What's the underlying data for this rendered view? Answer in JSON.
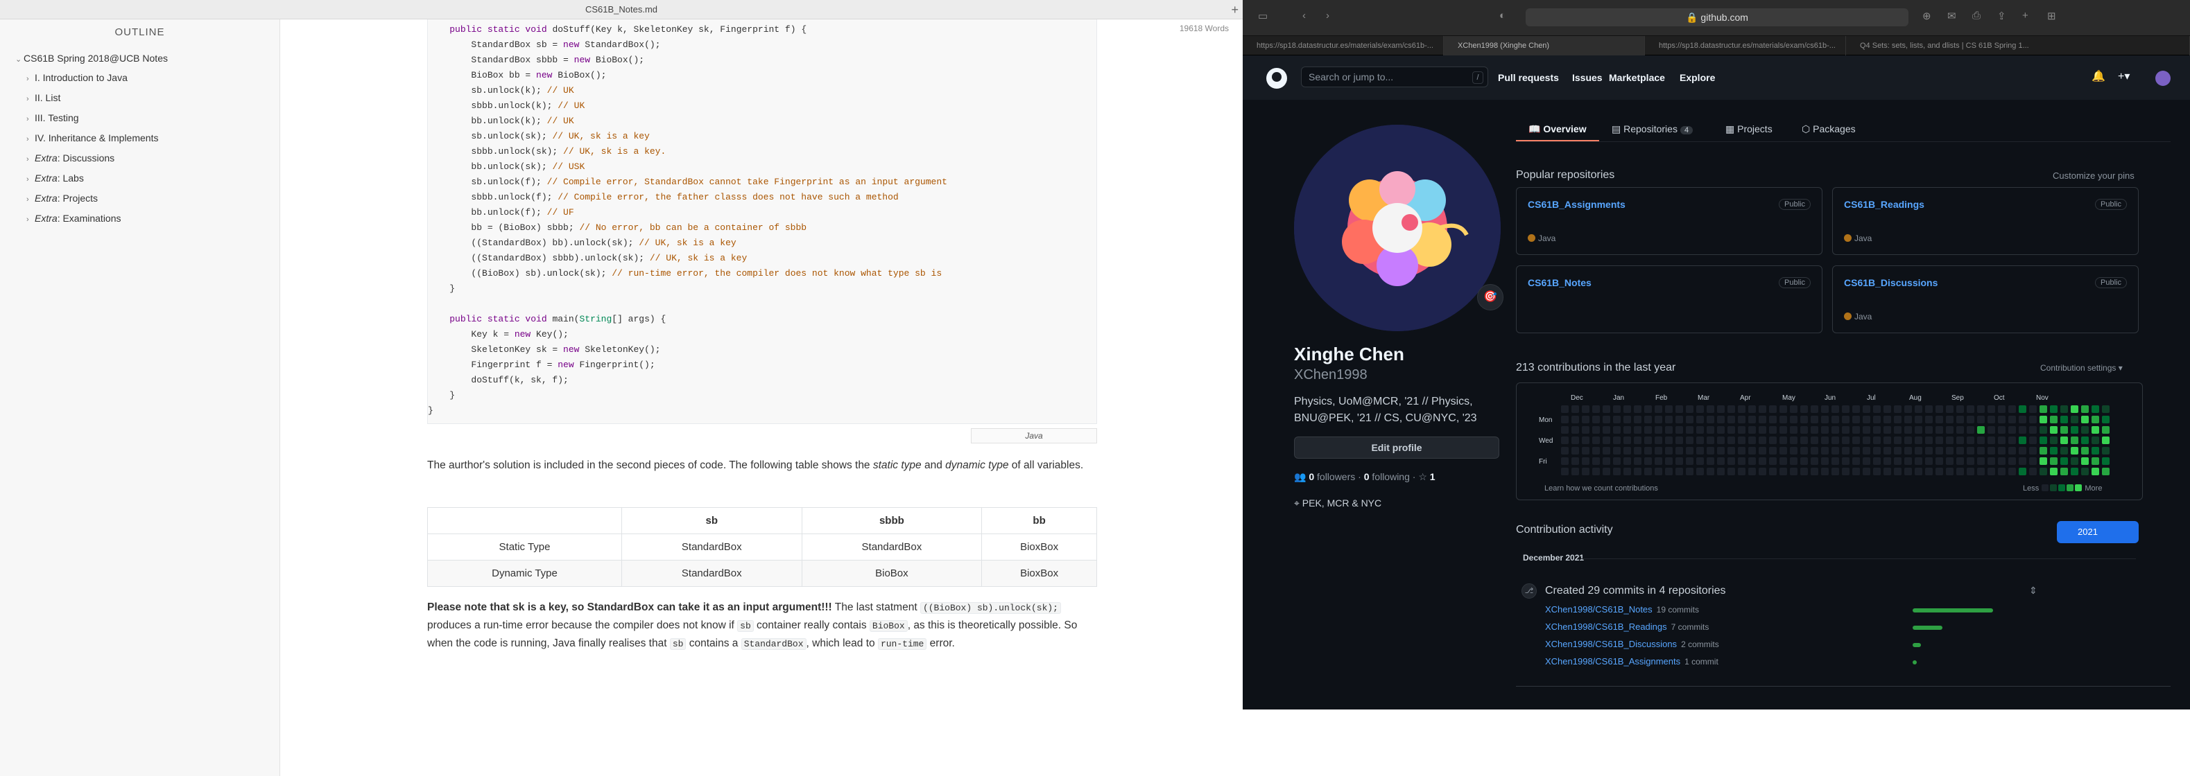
{
  "typora": {
    "window_title": "CS61B_Notes.md",
    "outline_header": "OUTLINE",
    "outline_root": "CS61B Spring 2018@UCB Notes",
    "outline_items": [
      {
        "prefix": "",
        "label": "I. Introduction to Java"
      },
      {
        "prefix": "",
        "label": "II. List"
      },
      {
        "prefix": "",
        "label": "III. Testing"
      },
      {
        "prefix": "",
        "label": "IV. Inheritance & Implements"
      },
      {
        "prefix": "Extra",
        "label": ": Discussions"
      },
      {
        "prefix": "Extra",
        "label": ": Labs"
      },
      {
        "prefix": "Extra",
        "label": ": Projects"
      },
      {
        "prefix": "Extra",
        "label": ": Examinations"
      }
    ],
    "word_count": "19618 Words",
    "code_lang": "Java",
    "paragraph1_a": "The aurthor's solution is included in the second pieces of code. The following table shows the ",
    "paragraph1_em1": "static type",
    "paragraph1_b": " and ",
    "paragraph1_em2": "dynamic type",
    "paragraph1_c": " of all variables.",
    "table": {
      "headers": [
        "",
        "sb",
        "sbbb",
        "bb"
      ],
      "rows": [
        [
          "Static Type",
          "StandardBox",
          "StandardBox",
          "BioxBox"
        ],
        [
          "Dynamic Type",
          "StandardBox",
          "BioBox",
          "BioxBox"
        ]
      ]
    },
    "note_bold": "Please note that sk is a key, so StandardBox can take it as an input argument!!!",
    "note_t1": " The last statment ",
    "note_code1": "((BioBox) sb).unlock(sk);",
    "note_t2": " produces a run-time error because the compiler does not know if ",
    "note_code2": "sb",
    "note_t3": " container really contais ",
    "note_code3": "BioBox",
    "note_t4": ", as this is theoretically possible. So when the code is running, Java finally realises that ",
    "note_code4": "sb",
    "note_t5": " contains a ",
    "note_code5": "StandardBox",
    "note_t6": ", which lead to ",
    "note_code6": "run-time",
    "note_t7": " error."
  },
  "safari": {
    "url": "github.com",
    "tabs": [
      "https://sp18.datastructur.es/materials/exam/cs61b-...",
      "XChen1998 (Xinghe Chen)",
      "https://sp18.datastructur.es/materials/exam/cs61b-...",
      "Q4 Sets: sets, lists, and dlists | CS 61B Spring 1..."
    ]
  },
  "github": {
    "search_placeholder": "Search or jump to...",
    "search_key": "/",
    "nav": [
      "Pull requests",
      "Issues",
      "Marketplace",
      "Explore"
    ],
    "profile_tabs": [
      {
        "label": "Overview",
        "count": ""
      },
      {
        "label": "Repositories",
        "count": "4"
      },
      {
        "label": "Projects",
        "count": ""
      },
      {
        "label": "Packages",
        "count": ""
      }
    ],
    "name": "Xinghe Chen",
    "login": "XChen1998",
    "bio": "Physics, UoM@MCR, '21 // Physics, BNU@PEK, '21 // CS, CU@NYC, '23",
    "edit_profile": "Edit profile",
    "followers": "0",
    "followers_label": "followers",
    "following": "0",
    "following_label": "following",
    "stars": "1",
    "location": "PEK, MCR & NYC",
    "popular_title": "Popular repositories",
    "customize": "Customize your pins",
    "repos": [
      {
        "name": "CS61B_Assignments",
        "visibility": "Public",
        "lang": "Java"
      },
      {
        "name": "CS61B_Readings",
        "visibility": "Public",
        "lang": "Java"
      },
      {
        "name": "CS61B_Notes",
        "visibility": "Public",
        "lang": ""
      },
      {
        "name": "CS61B_Discussions",
        "visibility": "Public",
        "lang": "Java"
      }
    ],
    "lang_color": "#b07219",
    "contrib_title": "213 contributions in the last year",
    "contrib_settings": "Contribution settings ▾",
    "months": [
      "Dec",
      "Jan",
      "Feb",
      "Mar",
      "Apr",
      "May",
      "Jun",
      "Jul",
      "Aug",
      "Sep",
      "Oct",
      "Nov"
    ],
    "days": [
      "Mon",
      "Wed",
      "Fri"
    ],
    "learn": "Learn how we count contributions",
    "less": "Less",
    "more": "More",
    "activity_title": "Contribution activity",
    "year": "2021",
    "month_head": "December 2021",
    "commit_head": "Created 29 commits in 4 repositories",
    "commits": [
      {
        "repo": "XChen1998/CS61B_Notes",
        "count": "19 commits",
        "n": 19
      },
      {
        "repo": "XChen1998/CS61B_Readings",
        "count": "7 commits",
        "n": 7
      },
      {
        "repo": "XChen1998/CS61B_Discussions",
        "count": "2 commits",
        "n": 2
      },
      {
        "repo": "XChen1998/CS61B_Assignments",
        "count": "1 commit",
        "n": 1
      }
    ],
    "green_levels": [
      "#161b22",
      "#0e4429",
      "#006d32",
      "#26a641",
      "#39d353"
    ]
  }
}
